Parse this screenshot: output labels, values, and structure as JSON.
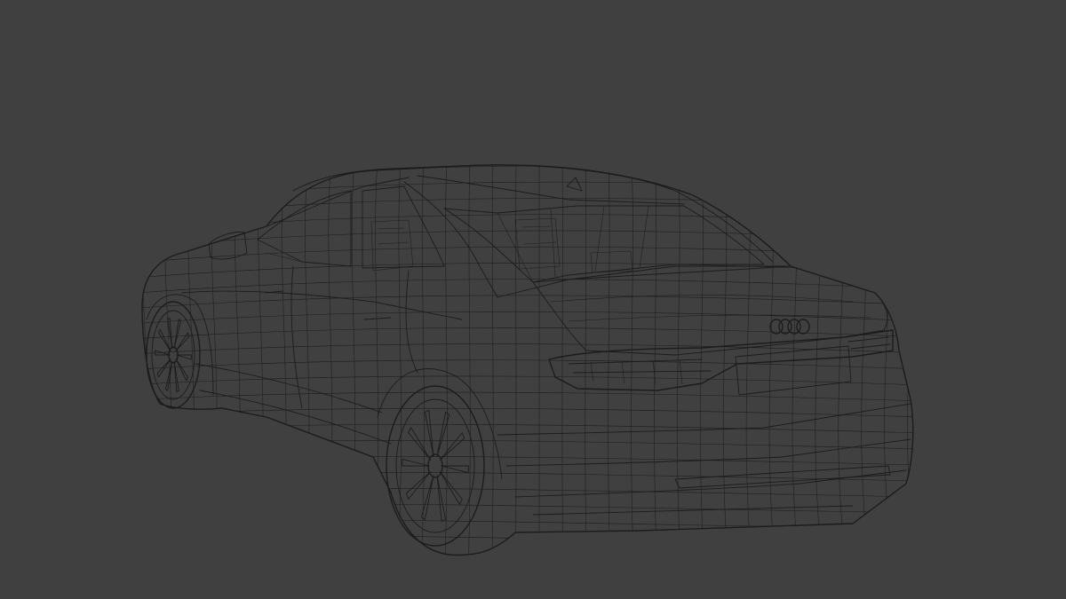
{
  "scene": {
    "background_color": "#404040",
    "wire_color": "#1c1c1c",
    "subject": "car-wireframe",
    "view": "rear-three-quarter"
  }
}
